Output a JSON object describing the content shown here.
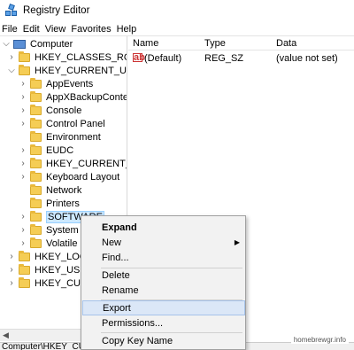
{
  "window": {
    "title": "Registry Editor"
  },
  "menu": [
    "File",
    "Edit",
    "View",
    "Favorites",
    "Help"
  ],
  "tree": {
    "root": "Computer",
    "items": [
      "HKEY_CLASSES_ROOT",
      "HKEY_CURRENT_USER",
      "AppEvents",
      "AppXBackupContentT",
      "Console",
      "Control Panel",
      "Environment",
      "EUDC",
      "HKEY_CURRENT_USER",
      "Keyboard Layout",
      "Network",
      "Printers",
      "SOFTWARE",
      "System",
      "Volatile En",
      "HKEY_LOCAL",
      "HKEY_USERS",
      "HKEY_CURRE"
    ]
  },
  "list": {
    "columns": [
      "Name",
      "Type",
      "Data"
    ],
    "rows": [
      {
        "name": "(Default)",
        "type": "REG_SZ",
        "data": "(value not set)"
      }
    ]
  },
  "context_menu": {
    "items": [
      "Expand",
      "New",
      "Find...",
      "Delete",
      "Rename",
      "Export",
      "Permissions...",
      "Copy Key Name"
    ]
  },
  "status": "Computer\\HKEY_CUR",
  "watermark": "homebrewgr.info"
}
